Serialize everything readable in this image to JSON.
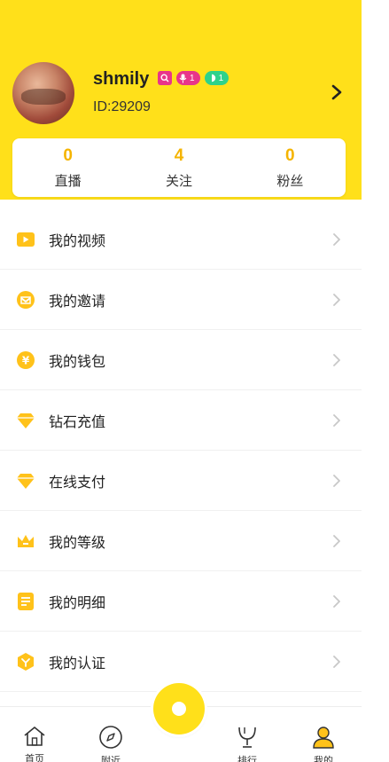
{
  "profile": {
    "username": "shmily",
    "user_id": "ID:29209",
    "badge_mic_level": "1",
    "badge_moon_level": "1"
  },
  "stats": [
    {
      "value": "0",
      "label": "直播"
    },
    {
      "value": "4",
      "label": "关注"
    },
    {
      "value": "0",
      "label": "粉丝"
    }
  ],
  "menu": [
    {
      "label": "我的视频",
      "icon": "video-icon"
    },
    {
      "label": "我的邀请",
      "icon": "invite-icon"
    },
    {
      "label": "我的钱包",
      "icon": "wallet-icon"
    },
    {
      "label": "钻石充值",
      "icon": "diamond-icon"
    },
    {
      "label": "在线支付",
      "icon": "diamond-icon"
    },
    {
      "label": "我的等级",
      "icon": "crown-icon"
    },
    {
      "label": "我的明细",
      "icon": "list-icon"
    },
    {
      "label": "我的认证",
      "icon": "verify-icon"
    }
  ],
  "tabs": [
    {
      "label": "首页",
      "icon": "home-icon"
    },
    {
      "label": "附近",
      "icon": "compass-icon"
    },
    {
      "label": "排行",
      "icon": "trophy-icon"
    },
    {
      "label": "我的",
      "icon": "user-icon"
    }
  ],
  "colors": {
    "accent": "#ffe01a",
    "number": "#f5b400",
    "icon": "#ffc21a",
    "badge_pink": "#e8358a",
    "badge_green": "#2ed28b"
  }
}
